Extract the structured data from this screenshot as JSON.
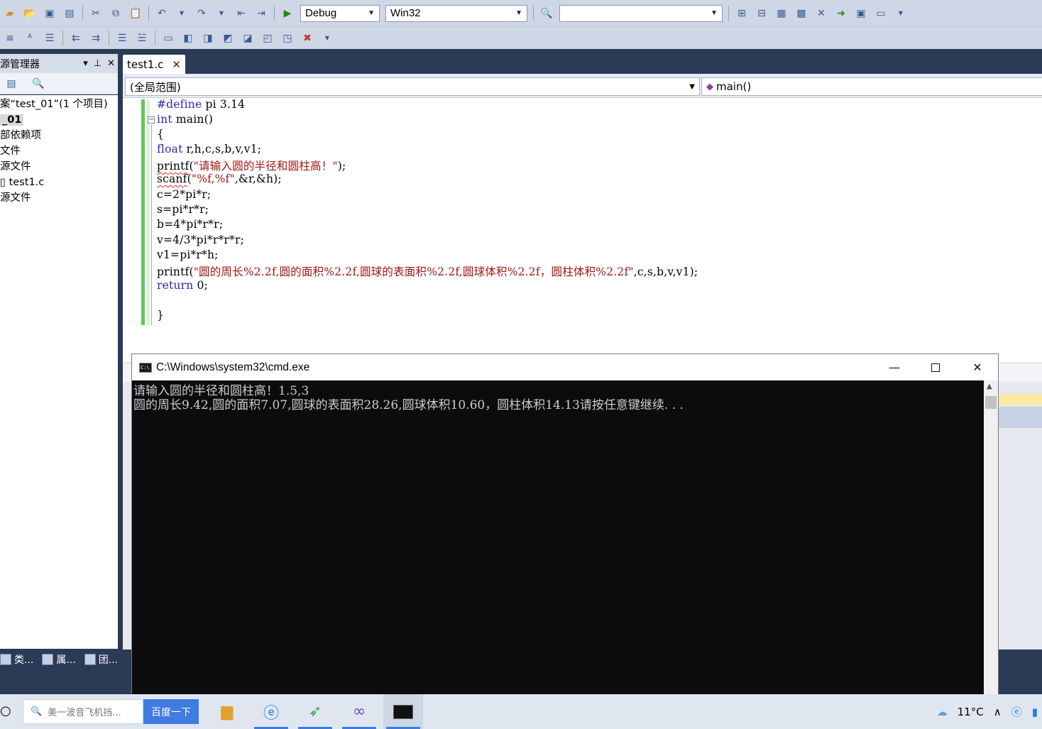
{
  "toolbar": {
    "config": "Debug",
    "platform": "Win32",
    "find_value": ""
  },
  "solution_explorer": {
    "title": "源管理器",
    "tree": [
      "案“test_01”(1 个项目)",
      "_01",
      "部依赖项",
      "文件",
      "源文件",
      "test1.c",
      "源文件"
    ],
    "bottom_tabs": [
      "类...",
      "属...",
      "团..."
    ]
  },
  "editor": {
    "tab_label": "test1.c",
    "scope": "(全局范围)",
    "member": "main()",
    "lines": [
      {
        "kw": "#define",
        "rest": " pi 3.14"
      },
      {
        "kw": "int",
        "rest": " main()"
      },
      {
        "kw": "",
        "rest": "{"
      },
      {
        "kw": "float",
        "rest": " r,h,c,s,b,v,v1;"
      },
      {
        "fn": "printf",
        "pre": "(",
        "str": "\"请输入圆的半径和圆柱高！\"",
        "post": ");"
      },
      {
        "fn": "scanf",
        "pre": "(",
        "str": "\"%f,%f\"",
        "post": ",&r,&h);"
      },
      {
        "kw": "",
        "rest": "c=2*pi*r;"
      },
      {
        "kw": "",
        "rest": "s=pi*r*r;"
      },
      {
        "kw": "",
        "rest": "b=4*pi*r*r;"
      },
      {
        "kw": "",
        "rest": "v=4/3*pi*r*r*r;"
      },
      {
        "kw": "",
        "rest": "v1=pi*r*h;"
      },
      {
        "fn2": "printf",
        "pre": "(",
        "str": "\"圆的周长%2.2f,圆的面积%2.2f,圆球的表面积%2.2f,圆球体积%2.2f，圆柱体积%2.2f\"",
        "post": ",c,s,b,v,v1);"
      },
      {
        "kw": "return",
        "rest": " 0;"
      },
      {
        "kw": "",
        "rest": ""
      },
      {
        "kw": "",
        "rest": "}"
      }
    ]
  },
  "console": {
    "title": "C:\\Windows\\system32\\cmd.exe",
    "output": [
      "请输入圆的半径和圆柱高！1.5,3",
      "圆的周长9.42,圆的面积7.07,圆球的表面积28.26,圆球体积10.60，圆柱体积14.13请按任意键继续. . ."
    ]
  },
  "taskbar": {
    "search_placeholder": "美一波音飞机挡...",
    "search_button": "百度一下",
    "weather": "11°C"
  },
  "colors": {
    "ide_frame": "#2b3a55",
    "keyword": "#2a2ab8",
    "string": "#a31515",
    "change_bar": "#5ec953",
    "console_bg": "#0c0c0c"
  }
}
